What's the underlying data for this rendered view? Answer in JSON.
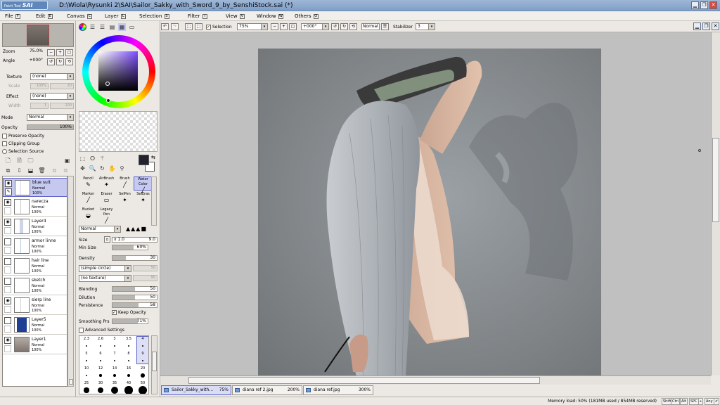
{
  "app": {
    "logo_small": "Paint Tool",
    "logo": "SAI",
    "title": "D:\\Wiola\\Rysunki 2\\SAI\\Sailor_Sakky_with_Sword_9_by_SenshiStock.sai (*)"
  },
  "menu": [
    {
      "label": "File",
      "key": "F"
    },
    {
      "label": "Edit",
      "key": "E"
    },
    {
      "label": "Canvas",
      "key": "C"
    },
    {
      "label": "Layer",
      "key": "L"
    },
    {
      "label": "Selection",
      "key": "S"
    },
    {
      "label": "Filter",
      "key": "I"
    },
    {
      "label": "View",
      "key": "V"
    },
    {
      "label": "Window",
      "key": "W"
    },
    {
      "label": "Others",
      "key": "O"
    }
  ],
  "navigator": {
    "zoom_label": "Zoom",
    "zoom_value": "75.0%",
    "angle_label": "Angle",
    "angle_value": "+000°"
  },
  "layer_props": {
    "texture_label": "Texture",
    "texture_value": "(none)",
    "scale_label": "Scale",
    "scale_value": "100%",
    "scale_num": "20",
    "effect_label": "Effect",
    "effect_value": "(none)",
    "width_label": "Width",
    "width_value": "1",
    "width_num": "100",
    "mode_label": "Mode",
    "mode_value": "Normal",
    "opacity_label": "Opacity",
    "opacity_value": "100%",
    "preserve_opacity": "Preserve Opacity",
    "clipping_group": "Clipping Group",
    "selection_source": "Selection Source"
  },
  "layers": [
    {
      "name": "blue suit",
      "mode": "Normal",
      "opacity": "100%",
      "visible": true,
      "selected": true
    },
    {
      "name": "narecza",
      "mode": "Normal",
      "opacity": "100%",
      "visible": true,
      "selected": false
    },
    {
      "name": "Layer4",
      "mode": "Normal",
      "opacity": "100%",
      "visible": true,
      "selected": false
    },
    {
      "name": "armor linne",
      "mode": "Normal",
      "opacity": "100%",
      "visible": false,
      "selected": false
    },
    {
      "name": "hair line",
      "mode": "Normal",
      "opacity": "100%",
      "visible": false,
      "selected": false
    },
    {
      "name": "sketch",
      "mode": "Normal",
      "opacity": "100%",
      "visible": false,
      "selected": false
    },
    {
      "name": "sierp line",
      "mode": "Normal",
      "opacity": "100%",
      "visible": true,
      "selected": false
    },
    {
      "name": "Layer5",
      "mode": "Normal",
      "opacity": "100%",
      "visible": false,
      "selected": false
    },
    {
      "name": "Layer1",
      "mode": "Normal",
      "opacity": "100%",
      "visible": true,
      "selected": false
    }
  ],
  "tools": [
    {
      "label": "Pencil",
      "glyph": "✎"
    },
    {
      "label": "AirBrush",
      "glyph": "✦"
    },
    {
      "label": "Brush",
      "glyph": "╱"
    },
    {
      "label": "Water Color",
      "glyph": "╱"
    },
    {
      "label": "Marker",
      "glyph": "╱"
    },
    {
      "label": "Eraser",
      "glyph": "▭"
    },
    {
      "label": "SelPen",
      "glyph": "✦"
    },
    {
      "label": "SelEras",
      "glyph": "✦"
    },
    {
      "label": "Bucket",
      "glyph": "◒"
    },
    {
      "label": "Legacy Pen",
      "glyph": "╱"
    }
  ],
  "brush": {
    "mode": "Normal",
    "size_label": "Size",
    "size_mult": "x 1.0",
    "size_value": "9.0",
    "min_size_label": "Min Size",
    "min_size_value": "60%",
    "min_size_fraction": 0.6,
    "density_label": "Density",
    "density_value": "30",
    "density_fraction": 0.3,
    "shape_value": "(simple circle)",
    "shape_num": "50",
    "texture_value": "(no texture)",
    "texture_num": "95",
    "blending_label": "Blending",
    "blending_value": "50",
    "blending_fraction": 0.5,
    "dilution_label": "Dilution",
    "dilution_value": "50",
    "dilution_fraction": 0.5,
    "persistence_label": "Persistence",
    "persistence_value": "58",
    "persistence_fraction": 0.58,
    "keep_opacity": "Keep Opacity",
    "smoothing_label": "Smoothing Prs",
    "smoothing_value": "71%",
    "smoothing_fraction": 0.71,
    "advanced_settings": "Advanced Settings",
    "sizes": [
      "2.3",
      "2.6",
      "3",
      "3.5",
      "4",
      "5",
      "6",
      "7",
      "8",
      "9",
      "10",
      "12",
      "14",
      "16",
      "20",
      "25",
      "30",
      "35",
      "40",
      "50"
    ]
  },
  "canvas_toolbar": {
    "selection_label": "Selection",
    "zoom_value": "75%",
    "angle_value": "+000°",
    "mode_value": "Normal",
    "stabilizer_label": "Stabilizer",
    "stabilizer_value": "3"
  },
  "doc_tabs": [
    {
      "name": "Sailor_Sakky_with...",
      "zoom": "75%",
      "selected": true
    },
    {
      "name": "diana ref 2.jpg",
      "zoom": "200%",
      "selected": false
    },
    {
      "name": "diana ref.jpg",
      "zoom": "300%",
      "selected": false
    }
  ],
  "status": {
    "memory": "Memory load: 50% (181MB used / 854MB reserved)",
    "keys": [
      "Shift",
      "Ctrl",
      "Alt",
      "SPC",
      "⌖",
      "Any",
      "✐"
    ]
  },
  "colors": {
    "accent_select": "#c5c9f0",
    "primary_color": "#23232e",
    "secondary_color": "#ffffff"
  }
}
